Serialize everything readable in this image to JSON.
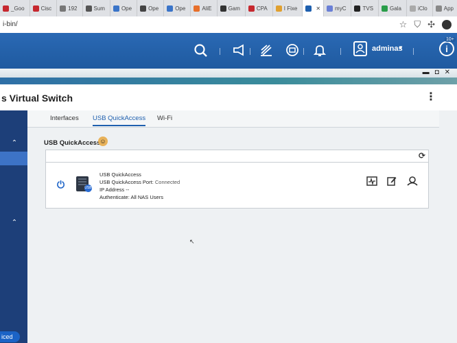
{
  "browser": {
    "tabs": [
      {
        "label": "_Goo",
        "color": "#c6282f"
      },
      {
        "label": "Cisc",
        "color": "#c6282f"
      },
      {
        "label": "192",
        "color": "#777777"
      },
      {
        "label": "Sum",
        "color": "#555555"
      },
      {
        "label": "Ope",
        "color": "#3a74c8"
      },
      {
        "label": "Ope",
        "color": "#444444"
      },
      {
        "label": "Ope",
        "color": "#3a74c8"
      },
      {
        "label": "AliE",
        "color": "#e76f2a"
      },
      {
        "label": "Gam",
        "color": "#333333"
      },
      {
        "label": "CPA",
        "color": "#c6282f"
      },
      {
        "label": "I Fixe",
        "color": "#e0a030"
      },
      {
        "label": "",
        "color": "#1e5fae",
        "active": true
      },
      {
        "label": "myC",
        "color": "#6a7fd6"
      },
      {
        "label": "TVS",
        "color": "#222222"
      },
      {
        "label": "Gala",
        "color": "#2a9d4a"
      },
      {
        "label": "iClo",
        "color": "#aaaaaa"
      },
      {
        "label": "App",
        "color": "#888888"
      }
    ],
    "new_tab": "+",
    "url": "i-bin/",
    "icons": {
      "star": "☆",
      "shield": "⛉",
      "puzzle": "✣"
    }
  },
  "qts_header": {
    "username": "adminas",
    "caret": "▼",
    "notifications_badge": "10+",
    "info": "i"
  },
  "window": {
    "controls": {
      "minimize": "▬",
      "restore": "◘",
      "close": "✕"
    }
  },
  "app": {
    "title": "s Virtual Switch",
    "menu": "⋮",
    "tabs": [
      {
        "label": "Interfaces",
        "active": false
      },
      {
        "label": "USB QuickAccess",
        "active": true
      },
      {
        "label": "Wi-Fi",
        "active": false
      }
    ],
    "section_title": "USB QuickAccess",
    "device": {
      "name": "USB QuickAccess",
      "port_label": "USB QuickAccess Port:",
      "port_status": "Connected",
      "ip_label": "IP Address",
      "ip_value": "--",
      "auth_label": "Authenticate:",
      "auth_value": "All NAS Users"
    },
    "sidebar": {
      "chevron": "⌃",
      "advanced_label": "iced"
    }
  },
  "colors": {
    "header_blue": "#2a69b4",
    "sidebar_navy": "#1d3f79",
    "accent": "#1e5fae",
    "power_blue": "#1e64c8"
  }
}
